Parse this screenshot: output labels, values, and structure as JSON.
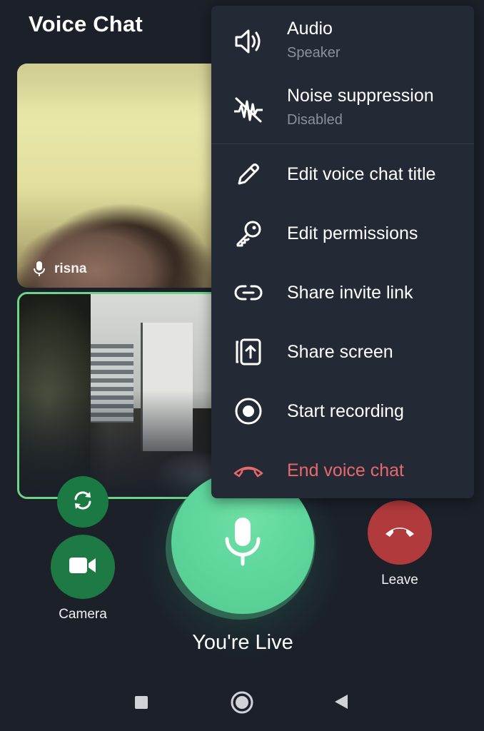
{
  "header": {
    "title": "Voice Chat"
  },
  "participants": [
    {
      "name": "risna",
      "mic": "mic-icon"
    }
  ],
  "controls": {
    "camera_label": "Camera",
    "leave_label": "Leave",
    "status": "You're Live"
  },
  "menu": {
    "items": [
      {
        "label": "Audio",
        "sub": "Speaker",
        "icon": "speaker-icon"
      },
      {
        "label": "Noise suppression",
        "sub": "Disabled",
        "icon": "noise-suppression-icon"
      },
      {
        "label": "Edit voice chat title",
        "icon": "pencil-icon"
      },
      {
        "label": "Edit permissions",
        "icon": "key-icon"
      },
      {
        "label": "Share invite link",
        "icon": "link-icon"
      },
      {
        "label": "Share screen",
        "icon": "share-screen-icon"
      },
      {
        "label": "Start recording",
        "icon": "record-icon"
      },
      {
        "label": "End voice chat",
        "icon": "hang-up-icon"
      }
    ]
  },
  "colors": {
    "background": "#1b2029",
    "menu": "#242a35",
    "accent_green": "#5ed69c",
    "danger": "#e8696b",
    "leave_button": "#b03a3c"
  }
}
